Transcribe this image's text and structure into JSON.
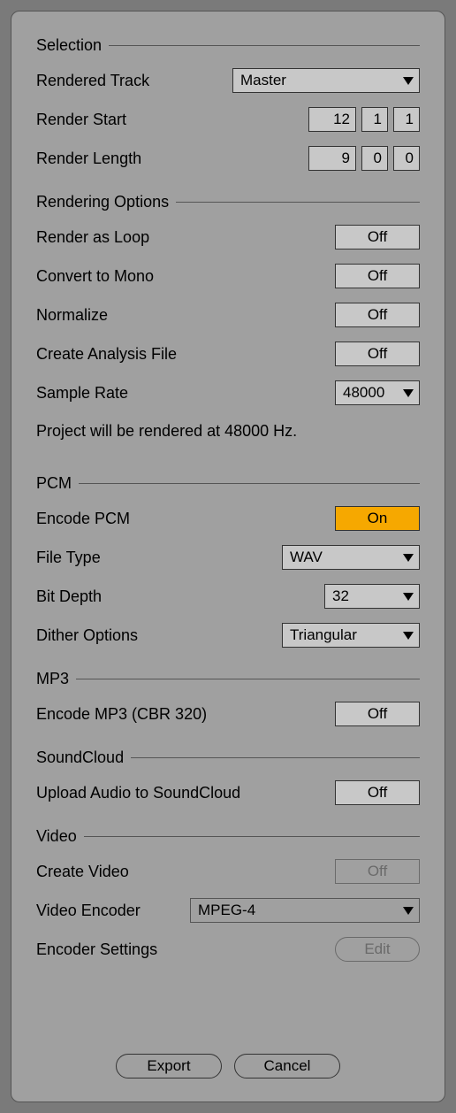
{
  "selection": {
    "header": "Selection",
    "rendered_track_label": "Rendered Track",
    "rendered_track_value": "Master",
    "render_start_label": "Render Start",
    "render_start": {
      "bars": "12",
      "beats": "1",
      "sixteenths": "1"
    },
    "render_length_label": "Render Length",
    "render_length": {
      "bars": "9",
      "beats": "0",
      "sixteenths": "0"
    }
  },
  "rendering": {
    "header": "Rendering Options",
    "render_as_loop_label": "Render as Loop",
    "render_as_loop_value": "Off",
    "convert_mono_label": "Convert to Mono",
    "convert_mono_value": "Off",
    "normalize_label": "Normalize",
    "normalize_value": "Off",
    "analysis_label": "Create Analysis File",
    "analysis_value": "Off",
    "sample_rate_label": "Sample Rate",
    "sample_rate_value": "48000",
    "info": "Project will be rendered at 48000 Hz."
  },
  "pcm": {
    "header": "PCM",
    "encode_label": "Encode PCM",
    "encode_value": "On",
    "file_type_label": "File Type",
    "file_type_value": "WAV",
    "bit_depth_label": "Bit Depth",
    "bit_depth_value": "32",
    "dither_label": "Dither Options",
    "dither_value": "Triangular"
  },
  "mp3": {
    "header": "MP3",
    "encode_label": "Encode MP3 (CBR 320)",
    "encode_value": "Off"
  },
  "soundcloud": {
    "header": "SoundCloud",
    "upload_label": "Upload Audio to SoundCloud",
    "upload_value": "Off"
  },
  "video": {
    "header": "Video",
    "create_label": "Create Video",
    "create_value": "Off",
    "encoder_label": "Video Encoder",
    "encoder_value": "MPEG-4",
    "settings_label": "Encoder Settings",
    "settings_button": "Edit"
  },
  "footer": {
    "export": "Export",
    "cancel": "Cancel"
  }
}
